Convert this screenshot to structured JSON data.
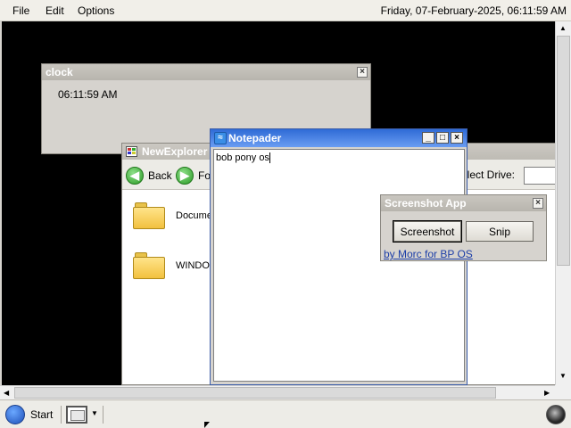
{
  "menubar": {
    "items": [
      "File",
      "Edit",
      "Options"
    ],
    "datetime": "Friday, 07-February-2025, 06:11:59 AM"
  },
  "clock_window": {
    "title": "clock",
    "time": "06:11:59 AM",
    "close": "×"
  },
  "explorer": {
    "title": "NewExplorer",
    "back_label": "Back",
    "forward_label": "Fo",
    "drive_label": "elect Drive:",
    "drive_value": "",
    "items": [
      "Docume",
      "WINDO"
    ]
  },
  "notepad": {
    "title": "Notepader",
    "content": "bob pony os",
    "minimize": "_",
    "maximize": "□",
    "close": "×"
  },
  "screenshot_app": {
    "title": "Screenshot App",
    "close": "×",
    "screenshot_button": "Screenshot",
    "snip_button": "Snip",
    "credit_link": "by Morc for BP OS"
  },
  "taskbar": {
    "start_label": "Start"
  },
  "colors": {
    "titlebar_active": "#2f6bd6",
    "titlebar_inactive": "#bdbab3",
    "link": "#1c3ea8"
  }
}
